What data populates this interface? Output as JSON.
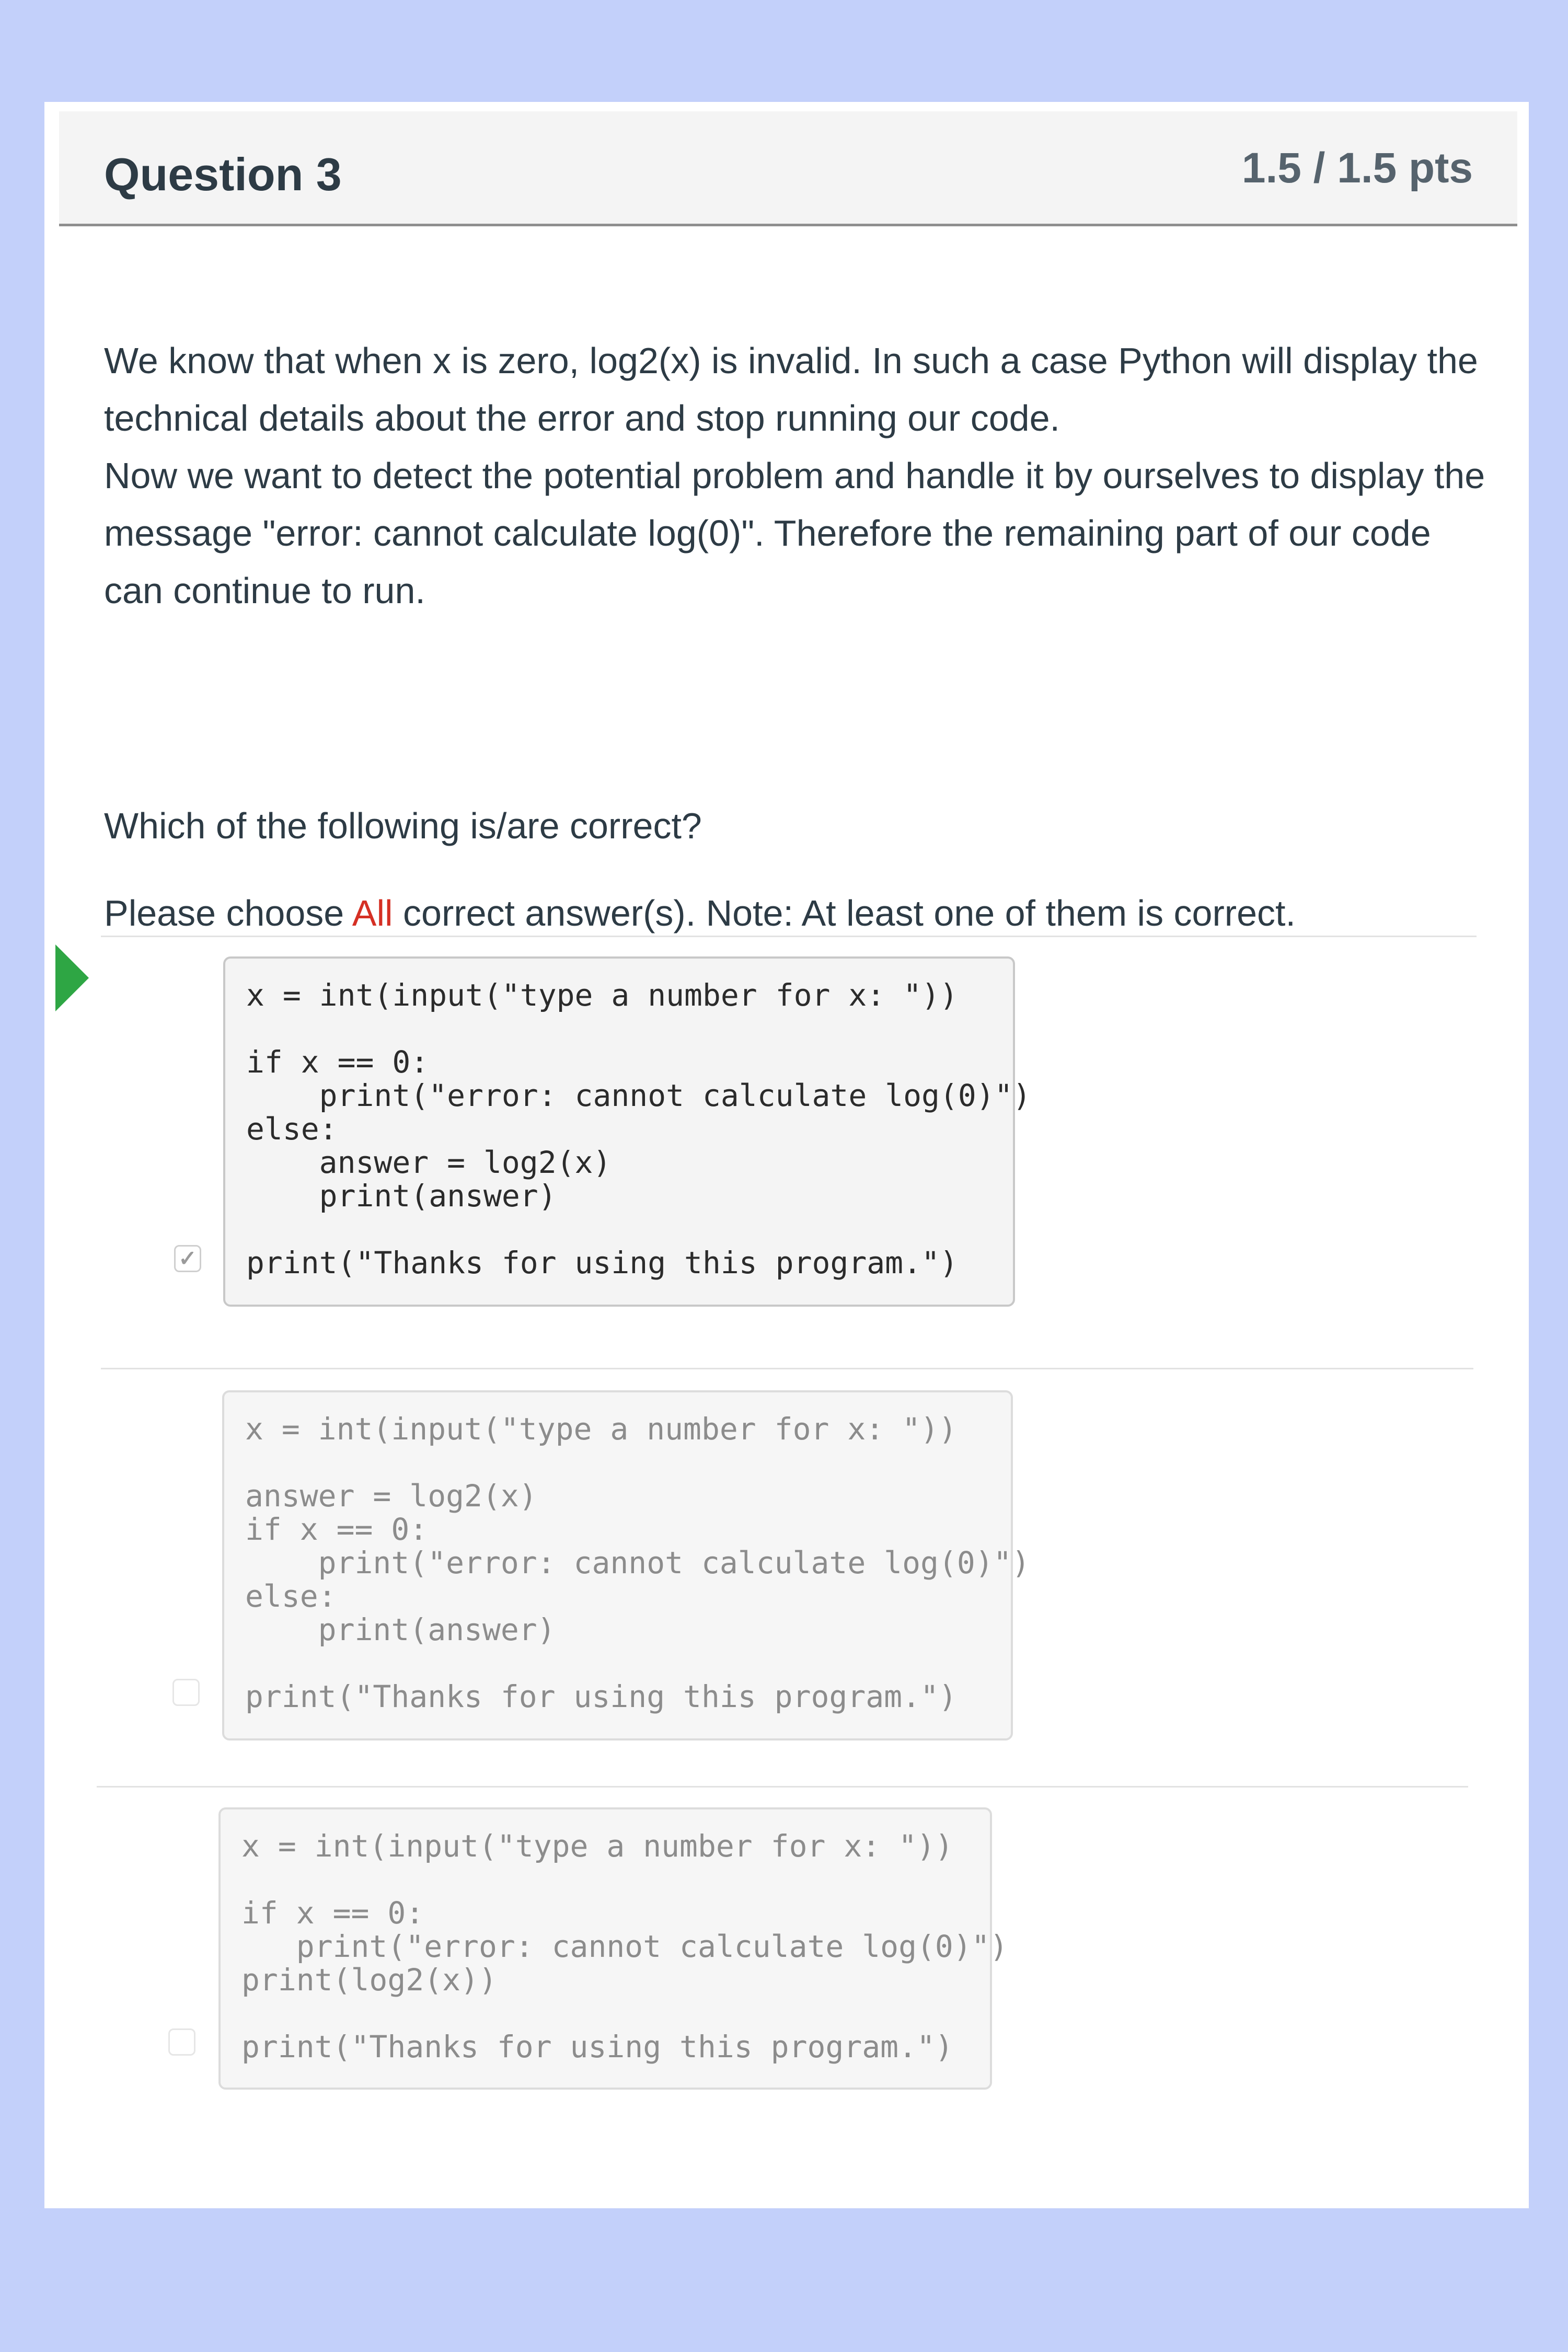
{
  "question": {
    "title": "Question 3",
    "points": "1.5 / 1.5 pts",
    "paragraph_1": "We know that when x is zero, log2(x) is invalid.  In such a case Python will display the technical details about the error and stop running our code.",
    "paragraph_2": "Now we want to detect the potential problem and handle it by ourselves to display the message \"error: cannot calculate log(0)\".  Therefore the remaining part of our code can continue to run.",
    "prompt": "Which of the following is/are correct?",
    "choose_prefix": "Please choose ",
    "choose_highlight": "All",
    "choose_suffix": " correct answer(s).  Note: At least one of them is correct."
  },
  "answers": [
    {
      "selected": true,
      "checkbox_mark": "✓",
      "code": "x = int(input(\"type a number for x: \"))\n\nif x == 0:\n    print(\"error: cannot calculate log(0)\")\nelse:\n    answer = log2(x)\n    print(answer)\n\nprint(\"Thanks for using this program.\")"
    },
    {
      "selected": false,
      "checkbox_mark": "",
      "code": "x = int(input(\"type a number for x: \"))\n\nanswer = log2(x)\nif x == 0:\n    print(\"error: cannot calculate log(0)\")\nelse:\n    print(answer)\n\nprint(\"Thanks for using this program.\")"
    },
    {
      "selected": false,
      "checkbox_mark": "",
      "code": "x = int(input(\"type a number for x: \"))\n\nif x == 0:\n   print(\"error: cannot calculate log(0)\")\nprint(log2(x))\n\nprint(\"Thanks for using this program.\")"
    }
  ],
  "colors": {
    "background": "#c3d0fa",
    "highlight": "#d53024",
    "correct_indicator": "#2ea644"
  }
}
